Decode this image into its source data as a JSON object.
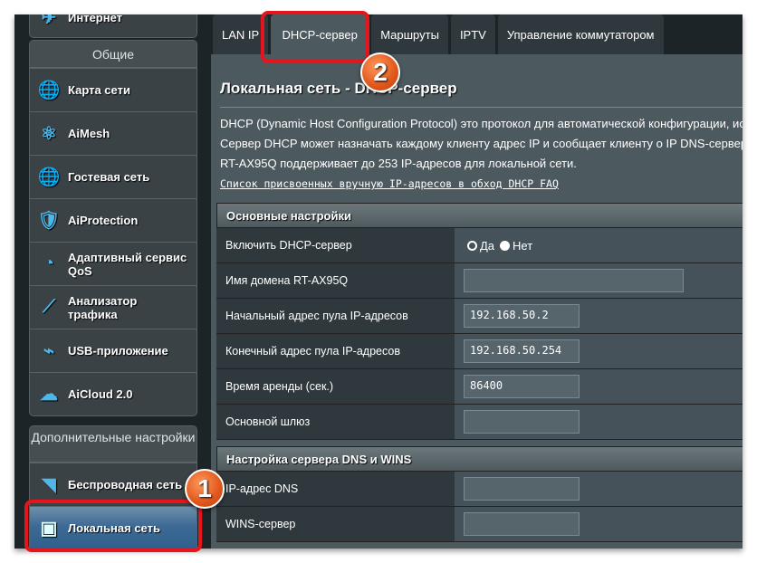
{
  "sidebar": {
    "top_item": "Интернет",
    "general_header": "Общие",
    "general_items": [
      {
        "label": "Карта сети",
        "icon": "globe-pin-icon"
      },
      {
        "label": "AiMesh",
        "icon": "mesh-icon"
      },
      {
        "label": "Гостевая сеть",
        "icon": "guest-network-icon"
      },
      {
        "label": "AiProtection",
        "icon": "shield-lock-icon"
      },
      {
        "label": "Адаптивный сервис QoS",
        "icon": "speedometer-icon"
      },
      {
        "label": "Анализатор трафика",
        "icon": "traffic-analyzer-icon"
      },
      {
        "label": "USB-приложение",
        "icon": "usb-icon"
      },
      {
        "label": "AiCloud 2.0",
        "icon": "cloud-icon"
      }
    ],
    "advanced_header": "Дополнительные настройки",
    "advanced_items": [
      {
        "label": "Беспроводная сеть",
        "icon": "wireless-icon"
      },
      {
        "label": "Локальная сеть",
        "icon": "lan-port-icon",
        "active": true
      }
    ]
  },
  "tabs": [
    {
      "label": "LAN IP"
    },
    {
      "label": "DHCP-сервер",
      "active": true
    },
    {
      "label": "Маршруты"
    },
    {
      "label": "IPTV"
    },
    {
      "label": "Управление коммутатором"
    }
  ],
  "page": {
    "title": "Локальная сеть - DHCP-сервер",
    "desc_lines": [
      "DHCP (Dynamic Host Configuration Protocol) это протокол для автоматической конфигурации, ис",
      "Сервер DHCP может назначать каждому клиенту адрес IP и сообщает клиенту о IP DNS-сервер",
      "RT-AX95Q поддерживает до 253 IP-адресов для локальной сети."
    ],
    "faq_link": "Список присвоенных вручную IP-адресов в обход DHCP FAQ"
  },
  "basic": {
    "header": "Основные настройки",
    "enable_label": "Включить DHCP-сервер",
    "yes": "Да",
    "no": "Нет",
    "enabled": false,
    "domain_label": "Имя домена RT-AX95Q",
    "domain_value": "",
    "start_label": "Начальный адрес пула IP-адресов",
    "start_value": "192.168.50.2",
    "end_label": "Конечный адрес пула IP-адресов",
    "end_value": "192.168.50.254",
    "lease_label": "Время аренды (сек.)",
    "lease_value": "86400",
    "gateway_label": "Основной шлюз",
    "gateway_value": ""
  },
  "dns": {
    "header": "Настройка сервера DNS и WINS",
    "dns_label": "IP-адрес DNS",
    "dns_value": "",
    "wins_label": "WINS-сервер",
    "wins_value": ""
  },
  "annotations": {
    "step1": "1",
    "step2": "2",
    "highlight_color": "#e8141b"
  }
}
